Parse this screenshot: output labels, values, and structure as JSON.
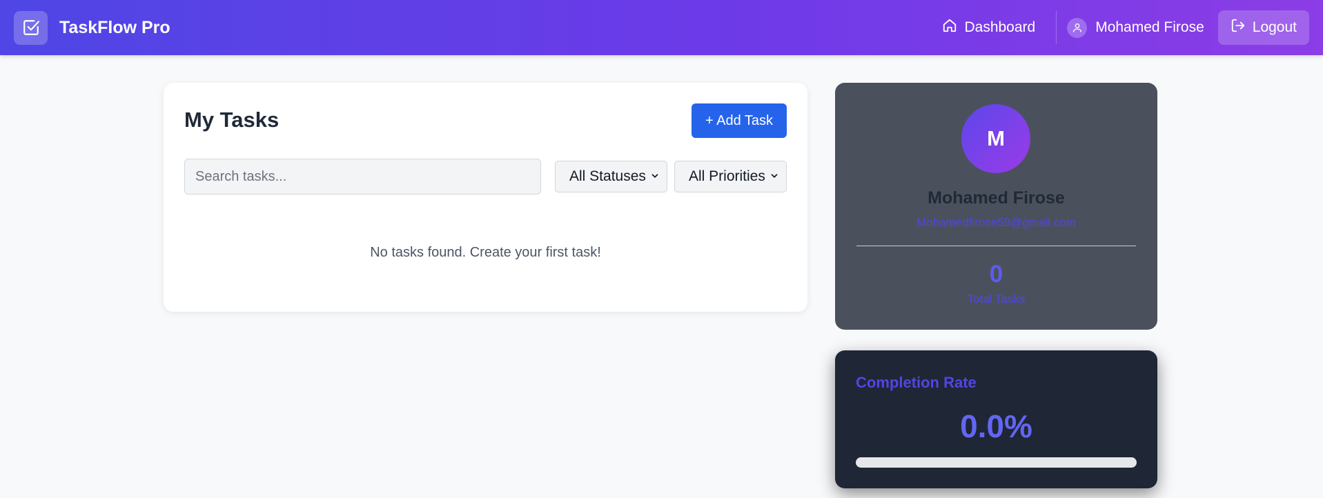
{
  "header": {
    "brand": "TaskFlow Pro",
    "nav": {
      "dashboard": "Dashboard"
    },
    "user_name": "Mohamed Firose",
    "logout": "Logout",
    "icons": {
      "brand": "check-square-icon",
      "dashboard": "home-icon",
      "user": "user-icon",
      "logout": "logout-icon"
    }
  },
  "tasks": {
    "title": "My Tasks",
    "add_button": "+ Add Task",
    "search_placeholder": "Search tasks...",
    "status_filter": "All Statuses",
    "priority_filter": "All Priorities",
    "empty_message": "No tasks found. Create your first task!"
  },
  "profile": {
    "initial": "M",
    "name": "Mohamed Firose",
    "email": "Mohamedfirose59@gmail.com",
    "total_tasks_value": "0",
    "total_tasks_label": "Total Tasks"
  },
  "completion": {
    "title": "Completion Rate",
    "value": "0.0%",
    "progress_fraction": 0
  },
  "colors": {
    "header_gradient_start": "#4f46e5",
    "header_gradient_end": "#8b3de6",
    "primary_button": "#2563eb",
    "accent": "#6366f1"
  }
}
